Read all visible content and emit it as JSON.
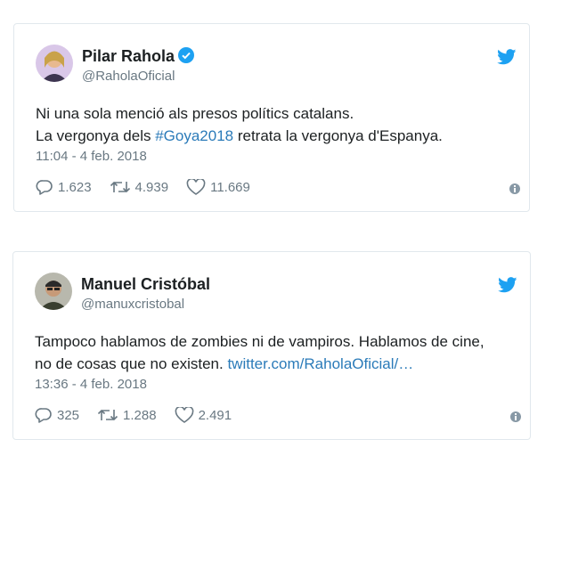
{
  "tweets": [
    {
      "name": "Pilar Rahola",
      "handle": "@RaholaOficial",
      "verified": true,
      "text_line1": "Ni una sola menció als presos polítics catalans.",
      "text_line2_pre": "La vergonya dels ",
      "hashtag": "#Goya2018",
      "text_line2_post": " retrata la vergonya d'Espanya.",
      "timestamp": "11:04 - 4 feb. 2018",
      "replies": "1.623",
      "retweets": "4.939",
      "likes": "11.669"
    },
    {
      "name": "Manuel Cristóbal",
      "handle": "@manuxcristobal",
      "verified": false,
      "text_line1": "Tampoco hablamos de zombies ni de vampiros. Hablamos de cine,",
      "text_line2_pre": "no de cosas que no existen. ",
      "link": "twitter.com/RaholaOficial/…",
      "timestamp": "13:36 - 4 feb. 2018",
      "replies": "325",
      "retweets": "1.288",
      "likes": "2.491"
    }
  ],
  "colors": {
    "link": "#2b7bb9",
    "twitter_blue": "#1da1f2",
    "muted": "#697882",
    "border": "#e1e8ed"
  },
  "icons": [
    "twitter-bird-icon",
    "verified-badge-icon",
    "reply-icon",
    "retweet-icon",
    "like-icon",
    "info-icon"
  ]
}
